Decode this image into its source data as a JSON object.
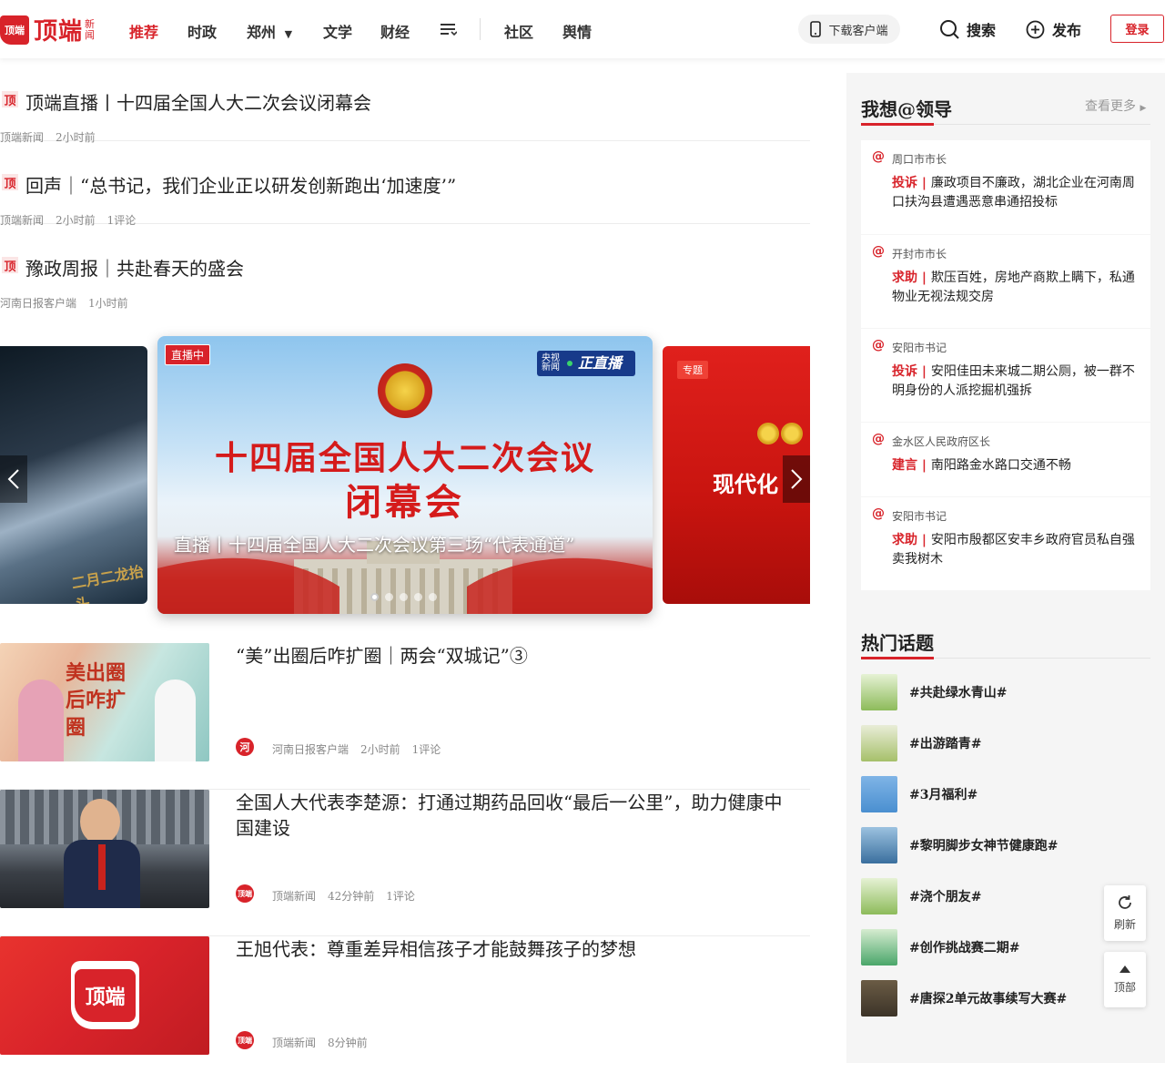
{
  "header": {
    "logo_badge": "顶端",
    "logo_text": "顶端",
    "logo_sub": "新闻",
    "nav": [
      "推荐",
      "时政",
      "郑州",
      "文学",
      "财经",
      "社区",
      "舆情"
    ],
    "download_label": "下载客户端",
    "search_label": "搜索",
    "publish_label": "发布",
    "login_label": "登录",
    "accent_color": "#d8232a"
  },
  "top_news": [
    {
      "badge": "顶",
      "title": "顶端直播丨十四届全国人大二次会议闭幕会",
      "source": "顶端新闻",
      "time": "2小时前",
      "comments": ""
    },
    {
      "badge": "顶",
      "title": "回声｜“总书记，我们企业正以研发创新跑出‘加速度’”",
      "source": "顶端新闻",
      "time": "2小时前",
      "comments": "1评论"
    },
    {
      "badge": "顶",
      "title": "豫政周报｜共赴春天的盛会",
      "source": "河南日报客户端",
      "time": "1小时前",
      "comments": ""
    }
  ],
  "carousel": {
    "live_badge": "直播中",
    "cctv_small": "央视新闻",
    "cctv_big": "正直播",
    "slide_title_line1": "十四届全国人大二次会议",
    "slide_title_line2": "闭幕会",
    "caption": "直播丨十四届全国人大二次会议第三场“代表通道”",
    "left_slide_text": "二月二龙抬头",
    "right_badge": "专题",
    "right_text": "现代化",
    "active_index": 0,
    "dot_count": 5
  },
  "articles": [
    {
      "title": "“美”出圈后咋扩圈｜两会“双城记”③",
      "source_icon": "河",
      "source": "河南日报客户端",
      "time": "2小时前",
      "comments": "1评论",
      "thumb_text": "美出圈后咋扩圈"
    },
    {
      "title": "全国人大代表李楚源：打通过期药品回收“最后一公里”，助力健康中国建设",
      "source_icon": "顶端",
      "source": "顶端新闻",
      "time": "42分钟前",
      "comments": "1评论",
      "thumb_text": ""
    },
    {
      "title": "王旭代表：尊重差异相信孩子才能鼓舞孩子的梦想",
      "source_icon": "顶端",
      "source": "顶端新闻",
      "time": "8分钟前",
      "comments": "",
      "thumb_text": "顶端"
    }
  ],
  "sidebar": {
    "leaders_title": "我想@领导",
    "more_label": "查看更多",
    "leaders": [
      {
        "who": "周口市市长",
        "tag": "投诉",
        "text": "廉政项目不廉政，湖北企业在河南周口扶沟县遭遇恶意串通招投标"
      },
      {
        "who": "开封市市长",
        "tag": "求助",
        "text": "欺压百姓，房地产商欺上瞒下，私通物业无视法规交房"
      },
      {
        "who": "安阳市书记",
        "tag": "投诉",
        "text": "安阳佳田未来城二期公厕，被一群不明身份的人派挖掘机强拆"
      },
      {
        "who": "金水区人民政府区长",
        "tag": "建言",
        "text": "南阳路金水路口交通不畅"
      },
      {
        "who": "安阳市书记",
        "tag": "求助",
        "text": "安阳市殷都区安丰乡政府官员私自强卖我树木"
      }
    ],
    "hot_title": "热门话题",
    "topics": [
      {
        "name": "#共赴绿水青山#",
        "color": "#8dbb5a"
      },
      {
        "name": "#出游踏青#",
        "color": "#a6c06a"
      },
      {
        "name": "#3月福利#",
        "color": "#4a8fd0"
      },
      {
        "name": "#黎明脚步女神节健康跑#",
        "color": "#3a6f9e"
      },
      {
        "name": "#浇个朋友#",
        "color": "#8dbb5a"
      },
      {
        "name": "#创作挑战赛二期#",
        "color": "#4aa66a"
      },
      {
        "name": "#唐探2单元故事续写大赛#",
        "color": "#3c3428"
      }
    ]
  },
  "floating": {
    "refresh_label": "刷新",
    "top_label": "顶部"
  }
}
